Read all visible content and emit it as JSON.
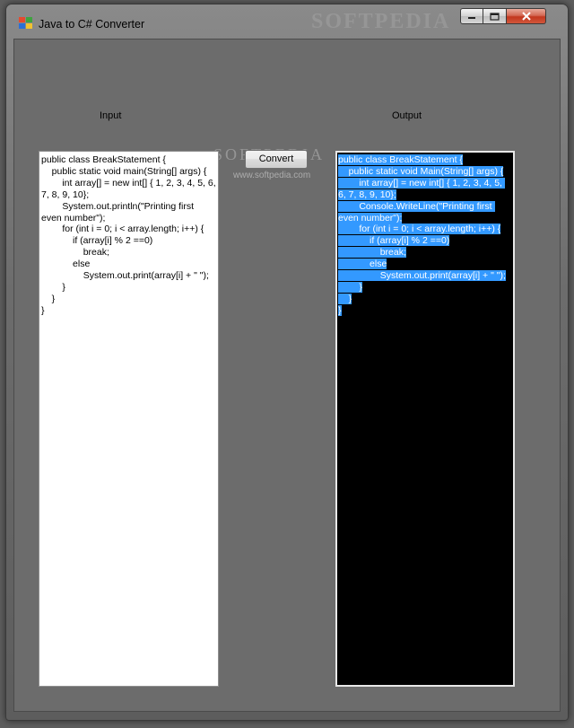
{
  "window": {
    "title": "Java to C# Converter",
    "watermark": "SOFTPEDIA"
  },
  "labels": {
    "input": "Input",
    "output": "Output"
  },
  "buttons": {
    "convert": "Convert"
  },
  "watermark": {
    "brand": "SOFTPEDIA",
    "url": "www.softpedia.com"
  },
  "input_code": "public class BreakStatement {\n    public static void main(String[] args) {\n        int array[] = new int[] { 1, 2, 3, 4, 5, 6, 7, 8, 9, 10};\n        System.out.println(\"Printing first even number\");\n        for (int i = 0; i < array.length; i++) {\n            if (array[i] % 2 ==0)\n                break;\n            else\n                System.out.print(array[i] + \" \");\n        }\n    }\n}",
  "output_code": "public class BreakStatement {\n    public static void Main(String[] args) {\n        int array[] = new int[] { 1, 2, 3, 4, 5, 6, 7, 8, 9, 10};\n        Console.WriteLine(\"Printing first even number\");\n        for (int i = 0; i < array.length; i++) {\n            if (array[i] % 2 ==0)\n                break;\n            else\n                System.out.print(array[i] + \" \");\n        }\n    }\n}",
  "colors": {
    "client_bg": "#6c6c6c",
    "selection": "#3399ff",
    "output_bg": "#000000",
    "input_bg": "#ffffff"
  }
}
